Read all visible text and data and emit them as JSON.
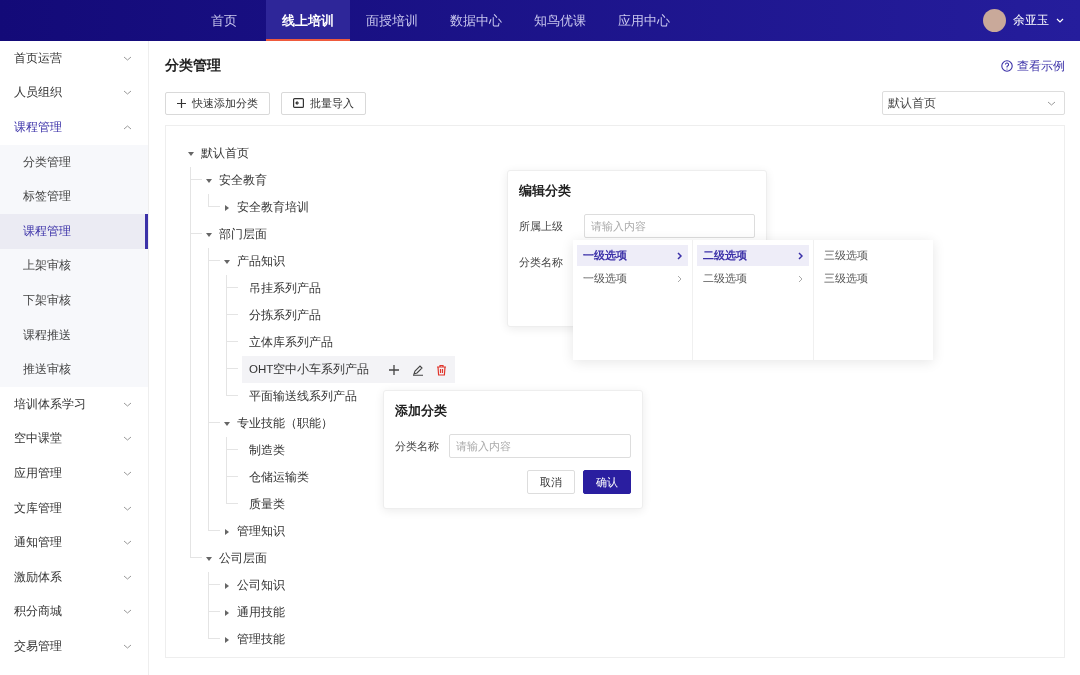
{
  "top_nav": {
    "tabs": [
      {
        "label": "首页",
        "selected": false
      },
      {
        "label": "线上培训",
        "selected": true
      },
      {
        "label": "面授培训",
        "selected": false
      },
      {
        "label": "数据中心",
        "selected": false
      },
      {
        "label": "知鸟优课",
        "selected": false
      },
      {
        "label": "应用中心",
        "selected": false
      }
    ],
    "user": {
      "name": "余亚玉"
    }
  },
  "sidebar": {
    "items": [
      {
        "label": "首页运营",
        "expanded": false,
        "selected": false
      },
      {
        "label": "人员组织",
        "expanded": false,
        "selected": false
      },
      {
        "label": "课程管理",
        "expanded": true,
        "selected": true,
        "children": [
          {
            "label": "分类管理",
            "selected": false
          },
          {
            "label": "标签管理",
            "selected": false
          },
          {
            "label": "课程管理",
            "selected": true
          },
          {
            "label": "上架审核",
            "selected": false
          },
          {
            "label": "下架审核",
            "selected": false
          },
          {
            "label": "课程推送",
            "selected": false
          },
          {
            "label": "推送审核",
            "selected": false
          }
        ]
      },
      {
        "label": "培训体系学习",
        "expanded": false,
        "selected": false
      },
      {
        "label": "空中课堂",
        "expanded": false,
        "selected": false
      },
      {
        "label": "应用管理",
        "expanded": false,
        "selected": false
      },
      {
        "label": "文库管理",
        "expanded": false,
        "selected": false
      },
      {
        "label": "通知管理",
        "expanded": false,
        "selected": false
      },
      {
        "label": "激励体系",
        "expanded": false,
        "selected": false
      },
      {
        "label": "积分商城",
        "expanded": false,
        "selected": false
      },
      {
        "label": "交易管理",
        "expanded": false,
        "selected": false
      }
    ]
  },
  "page": {
    "title": "分类管理",
    "help_link": "查看示例",
    "buttons": [
      {
        "label": "快速添加分类",
        "kind": "add"
      },
      {
        "label": "批量导入",
        "kind": "import"
      }
    ],
    "scope_select": {
      "value": "默认首页"
    }
  },
  "tree": [
    {
      "label": "默认首页",
      "expanded": true,
      "hovered": false,
      "children": [
        {
          "label": "安全教育",
          "expanded": true,
          "hovered": false,
          "children": [
            {
              "label": "安全教育培训",
              "expanded": false,
              "hovered": false
            }
          ]
        },
        {
          "label": "部门层面",
          "expanded": true,
          "hovered": false,
          "children": [
            {
              "label": "产品知识",
              "expanded": true,
              "hovered": false,
              "children": [
                {
                  "label": "吊挂系列产品",
                  "hovered": false
                },
                {
                  "label": "分拣系列产品",
                  "hovered": false
                },
                {
                  "label": "立体库系列产品",
                  "hovered": false
                },
                {
                  "label": "OHT空中小车系列产品",
                  "hovered": true
                },
                {
                  "label": "平面输送线系列产品",
                  "hovered": false
                }
              ]
            },
            {
              "label": "专业技能（职能）",
              "expanded": true,
              "hovered": false,
              "children": [
                {
                  "label": "制造类",
                  "hovered": false
                },
                {
                  "label": "仓储运输类",
                  "hovered": false
                },
                {
                  "label": "质量类",
                  "hovered": false
                }
              ]
            },
            {
              "label": "管理知识",
              "expanded": false,
              "hovered": false
            }
          ]
        },
        {
          "label": "公司层面",
          "expanded": true,
          "hovered": false,
          "children": [
            {
              "label": "公司知识",
              "expanded": false,
              "hovered": false
            },
            {
              "label": "通用技能",
              "expanded": false,
              "hovered": false
            },
            {
              "label": "管理技能",
              "expanded": false,
              "hovered": false
            }
          ]
        }
      ]
    }
  ],
  "edit_dialog": {
    "title": "编辑分类",
    "fields": [
      {
        "label": "所属上级",
        "placeholder": "请输入内容"
      },
      {
        "label": "分类名称"
      }
    ]
  },
  "cascader": {
    "columns": [
      [
        {
          "label": "一级选项",
          "selected": true,
          "has_children": true
        },
        {
          "label": "一级选项",
          "selected": false,
          "has_children": true
        }
      ],
      [
        {
          "label": "二级选项",
          "selected": true,
          "has_children": true
        },
        {
          "label": "二级选项",
          "selected": false,
          "has_children": true
        }
      ],
      [
        {
          "label": "三级选项",
          "selected": false,
          "has_children": false
        },
        {
          "label": "三级选项",
          "selected": false,
          "has_children": false
        }
      ]
    ]
  },
  "add_dialog": {
    "title": "添加分类",
    "field": {
      "label": "分类名称",
      "placeholder": "请输入内容"
    },
    "buttons": [
      {
        "label": "取消",
        "kind": "secondary"
      },
      {
        "label": "确认",
        "kind": "primary"
      }
    ]
  }
}
